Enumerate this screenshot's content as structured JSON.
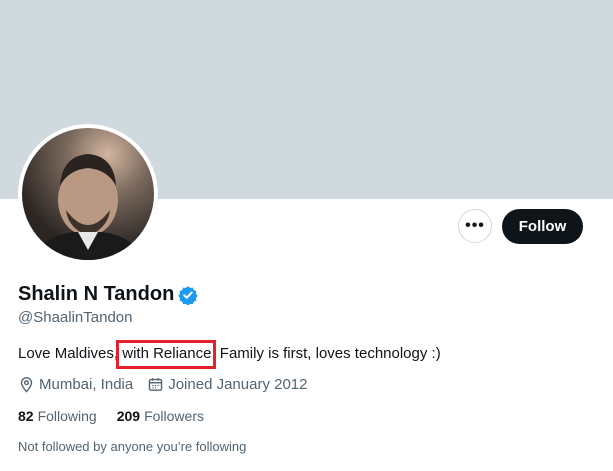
{
  "profile": {
    "display_name": "Shalin N Tandon",
    "handle": "@ShaalinTandon",
    "verified_icon": "verified-badge-icon",
    "bio_before": "Love Maldives,",
    "bio_highlight": "with Reliance,",
    "bio_after": "Family is first, loves technology :)",
    "location": "Mumbai, India",
    "joined": "Joined January 2012",
    "following_count": "82",
    "following_label": "Following",
    "followers_count": "209",
    "followers_label": "Followers",
    "followed_note": "Not followed by anyone you’re following"
  },
  "actions": {
    "more_label": "•••",
    "follow_label": "Follow"
  },
  "colors": {
    "banner": "#cfd9de",
    "follow_button": "#0f1419",
    "verified": "#1d9bf0",
    "secondary_text": "#536471",
    "highlight": "#e3202b"
  }
}
